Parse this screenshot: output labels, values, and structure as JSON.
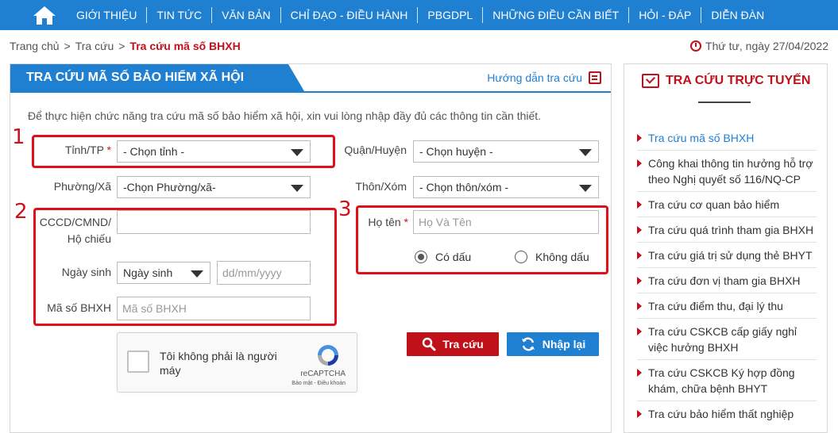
{
  "nav": {
    "items": [
      "GIỚI THIỆU",
      "TIN TỨC",
      "VĂN BẢN",
      "CHỈ ĐẠO - ĐIỀU HÀNH",
      "PBGDPL",
      "NHỮNG ĐIỀU CẦN BIẾT",
      "HỎI - ĐÁP",
      "DIỄN ĐÀN"
    ]
  },
  "breadcrumb": {
    "home": "Trang chủ",
    "level2": "Tra cứu",
    "current": "Tra cứu mã số BHXH",
    "separator": ">"
  },
  "date": "Thứ tư, ngày 27/04/2022",
  "panel": {
    "title": "TRA CỨU MÃ SỐ BẢO HIỂM XÃ HỘI",
    "guide": "Hướng dẫn tra cứu",
    "intro": "Để thực hiện chức năng tra cứu mã số bảo hiểm xã hội, xin vui lòng nhập đầy đủ các thông tin cần thiết."
  },
  "form": {
    "province_label": "Tỉnh/TP",
    "required_mark": "*",
    "province_value": "- Chọn tỉnh -",
    "district_label": "Quận/Huyện",
    "district_value": "- Chọn huyện -",
    "ward_label": "Phường/Xã",
    "ward_value": "-Chọn Phường/xã-",
    "village_label": "Thôn/Xóm",
    "village_value": "- Chọn thôn/xóm -",
    "id_label_line1": "CCCD/CMND/",
    "id_label_line2": "Hộ chiếu",
    "id_value": "",
    "dob_label": "Ngày sinh",
    "dob_select": "Ngày sinh",
    "dob_placeholder": "dd/mm/yyyy",
    "bhxh_label": "Mã số BHXH",
    "bhxh_placeholder": "Mã số BHXH",
    "name_label": "Họ tên",
    "name_placeholder": "Họ Và Tên",
    "radio_accent": "Có dấu",
    "radio_no_accent": "Không dấu",
    "radio_selected": "Có dấu"
  },
  "annotations": [
    "1",
    "2",
    "3"
  ],
  "captcha": {
    "text": "Tôi không phải là người máy",
    "brand": "reCAPTCHA",
    "terms": "Bảo mật - Điều khoản"
  },
  "buttons": {
    "search": "Tra cứu",
    "reset": "Nhập lại"
  },
  "sidebar": {
    "title": "TRA CỨU TRỰC TUYẾN",
    "items": [
      "Tra cứu mã số BHXH",
      "Công khai thông tin hưởng hỗ trợ theo Nghị quyết số 116/NQ-CP",
      "Tra cứu cơ quan bảo hiểm",
      "Tra cứu quá trình tham gia BHXH",
      "Tra cứu giá trị sử dụng thẻ BHYT",
      "Tra cứu đơn vị tham gia BHXH",
      "Tra cứu điểm thu, đại lý thu",
      "Tra cứu CSKCB cấp giấy nghỉ việc hưởng BHXH",
      "Tra cứu CSKCB Ký hợp đồng khám, chữa bệnh BHYT",
      "Tra cứu bảo hiểm thất nghiệp"
    ]
  },
  "colors": {
    "brand_blue": "#1f7fd1",
    "accent_red": "#c0101a",
    "annotation_red": "#e0101a"
  },
  "icons": [
    "home-icon",
    "clock-icon",
    "edit-icon",
    "dropdown-arrow-icon",
    "search-icon",
    "refresh-icon",
    "recaptcha-logo-icon",
    "checklist-icon",
    "list-bullet-icon"
  ]
}
